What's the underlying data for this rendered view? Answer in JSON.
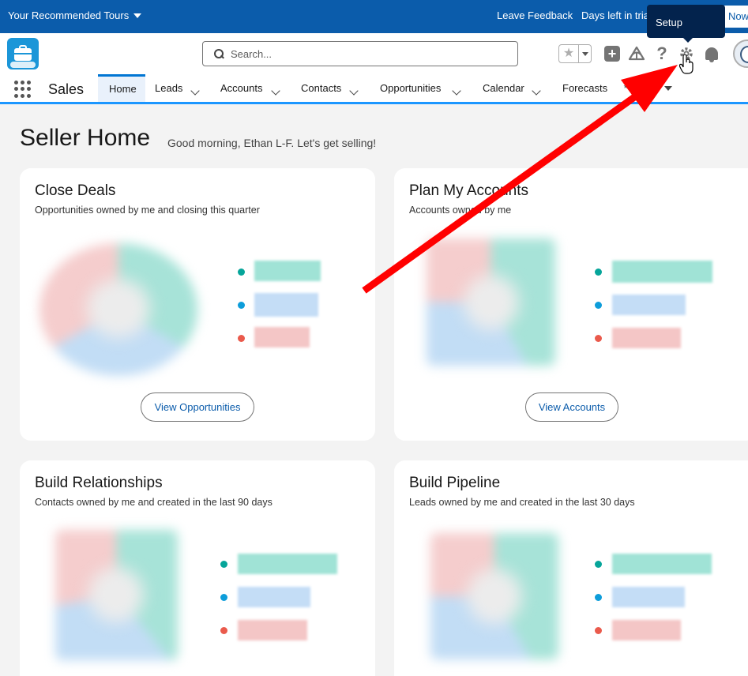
{
  "topbar": {
    "tours_label": "Your Recommended Tours",
    "feedback_label": "Leave Feedback",
    "trial_label": "Days left in trial",
    "buy_label": "Now"
  },
  "header": {
    "search_placeholder": "Search...",
    "tooltip": "Setup",
    "icons": [
      "favorites-star-icon",
      "global-actions-plus-icon",
      "trailhead-icon",
      "help-icon",
      "setup-gear-icon",
      "notifications-bell-icon",
      "user-avatar"
    ]
  },
  "nav": {
    "app_name": "Sales",
    "tabs": [
      {
        "label": "Home",
        "active": true
      },
      {
        "label": "Leads"
      },
      {
        "label": "Accounts"
      },
      {
        "label": "Contacts"
      },
      {
        "label": "Opportunities"
      },
      {
        "label": "Calendar"
      },
      {
        "label": "Forecasts"
      },
      {
        "label": "* More"
      }
    ]
  },
  "page": {
    "title": "Seller Home",
    "greeting": "Good morning, Ethan L-F. Let's get selling!"
  },
  "cards": [
    {
      "title": "Close Deals",
      "subtitle": "Opportunities owned by me and closing this quarter",
      "button": "View Opportunities"
    },
    {
      "title": "Plan My Accounts",
      "subtitle": "Accounts owned by me",
      "button": "View Accounts"
    },
    {
      "title": "Build Relationships",
      "subtitle": "Contacts owned by me and created in the last 90 days"
    },
    {
      "title": "Build Pipeline",
      "subtitle": "Leads owned by me and created in the last 30 days"
    }
  ],
  "colors": {
    "brand_blue": "#0b5cab",
    "accent_blue": "#1b96ff",
    "teal": "#06a59a",
    "blue": "#0d9dda",
    "red": "#ea5a4c",
    "arrow_red": "#ff0000"
  }
}
